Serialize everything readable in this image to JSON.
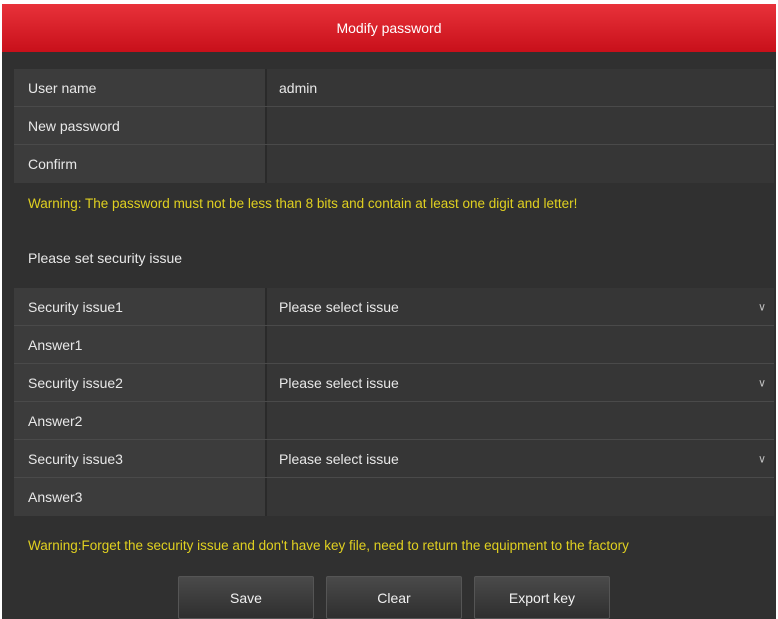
{
  "dialog": {
    "title": "Modify password"
  },
  "fields": {
    "username_label": "User name",
    "username_value": "admin",
    "new_password_label": "New password",
    "confirm_label": "Confirm"
  },
  "warning_password": "Warning: The password must not be less than 8 bits and contain at least one digit and letter!",
  "security_heading": "Please set security issue",
  "security": [
    {
      "issue_label": "Security issue1",
      "issue_value": "Please select issue",
      "answer_label": "Answer1"
    },
    {
      "issue_label": "Security issue2",
      "issue_value": "Please select issue",
      "answer_label": "Answer2"
    },
    {
      "issue_label": "Security issue3",
      "issue_value": "Please select issue",
      "answer_label": "Answer3"
    }
  ],
  "warning_security": "Warning:Forget the security issue and don't have key file, need to return the equipment to the factory",
  "buttons": {
    "save": "Save",
    "clear": "Clear",
    "export_key": "Export key"
  },
  "icons": {
    "dropdown": "chevron-down-icon"
  },
  "colors": {
    "titlebar": "#d01c24",
    "warning": "#e0d020"
  }
}
